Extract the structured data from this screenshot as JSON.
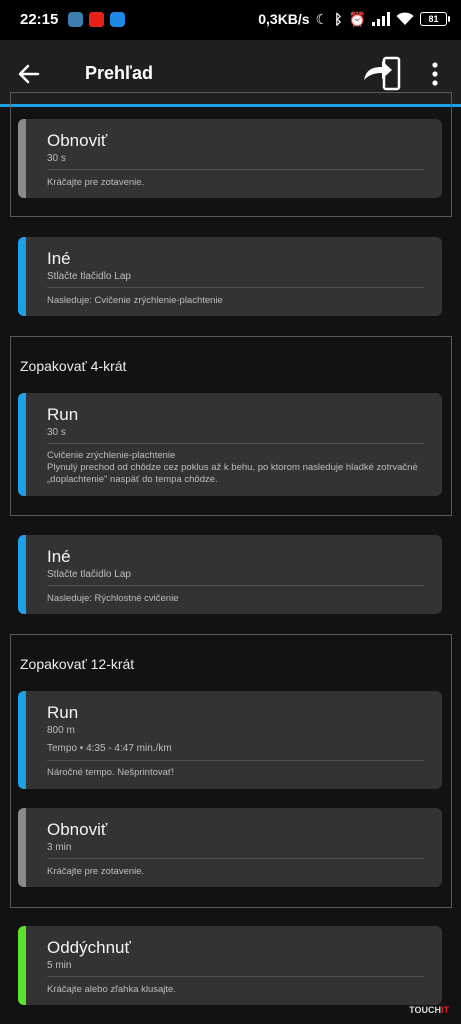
{
  "statusbar": {
    "time": "22:15",
    "speed": "0,3KB/s",
    "battery": "81"
  },
  "appbar": {
    "title": "Prehľad",
    "icons": [
      "back-arrow-icon",
      "send-to-device-icon",
      "more-vert-icon"
    ]
  },
  "cards": [
    {
      "title": "Obnoviť",
      "sub": "30 s",
      "note": "Kráčajte pre zotavenie."
    },
    {
      "title": "Iné",
      "sub": "Stlačte tlačidlo Lap",
      "note": "Nasleduje: Cvičenie zrýchlenie-plachtenie"
    },
    {
      "title": "Run",
      "sub": "30 s",
      "note": "Cvičenie zrýchlenie-plachtenie\nPlynulý prechod od chôdze cez poklus až k behu, po ktorom nasleduje hladké zotrvačné „doplachtenie\" naspäť do tempa chôdze."
    },
    {
      "title": "Iné",
      "sub": "Stlačte tlačidlo Lap",
      "note": "Nasleduje: Rýchlostné cvičenie"
    },
    {
      "title": "Run",
      "sub": "800 m",
      "sub2": "Tempo • 4:35 - 4:47 min./km",
      "note": "Náročné tempo. Nešprintovať!"
    },
    {
      "title": "Obnoviť",
      "sub": "3 min",
      "note": "Kráčajte pre zotavenie."
    },
    {
      "title": "Oddýchnuť",
      "sub": "5 min",
      "note": "Kráčajte alebo zľahka klusajte."
    }
  ],
  "groups": [
    {
      "title": "Zopakovať 4-krát"
    },
    {
      "title": "Zopakovať 12-krát"
    }
  ],
  "watermark": {
    "a": "TOUCH",
    "b": "IT"
  },
  "colors": {
    "accent": "#1ea0e6",
    "run": "#1ea0e6",
    "recover": "#8a8a8a",
    "rest": "#5ee02e",
    "card": "#333335",
    "background": "#121212"
  }
}
